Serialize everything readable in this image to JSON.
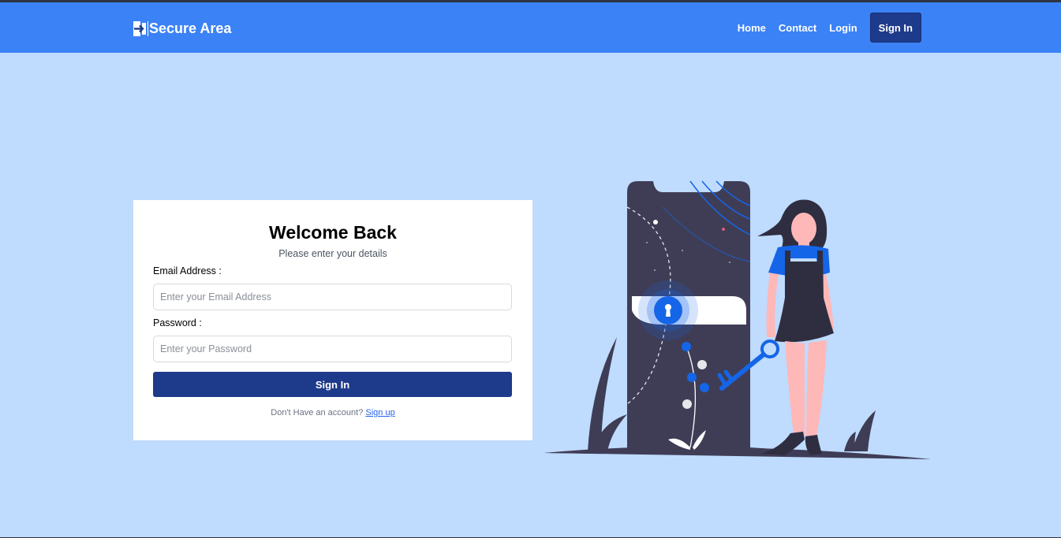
{
  "navbar": {
    "brand": "Secure Area",
    "brand_icon": "sign-in-icon",
    "links": [
      "Home",
      "Contact",
      "Login"
    ],
    "signin_label": "Sign In",
    "background": "#3b82f6",
    "button_color": "#1e3a8a"
  },
  "login": {
    "title": "Welcome Back",
    "subtitle": "Please enter your details",
    "email_label": "Email Address :",
    "email_placeholder": "Enter your Email Address",
    "email_value": "",
    "password_label": "Password :",
    "password_placeholder": "Enter your Password",
    "password_value": "",
    "submit_label": "Sign In",
    "signup_prompt": "Don't Have an account?",
    "signup_link": "Sign up"
  },
  "illustration": {
    "icon": "phone-lock-woman-key-illustration",
    "accent": "#1565e8"
  },
  "theme": {
    "page_background": "#bfdbfe",
    "card_background": "#ffffff"
  }
}
